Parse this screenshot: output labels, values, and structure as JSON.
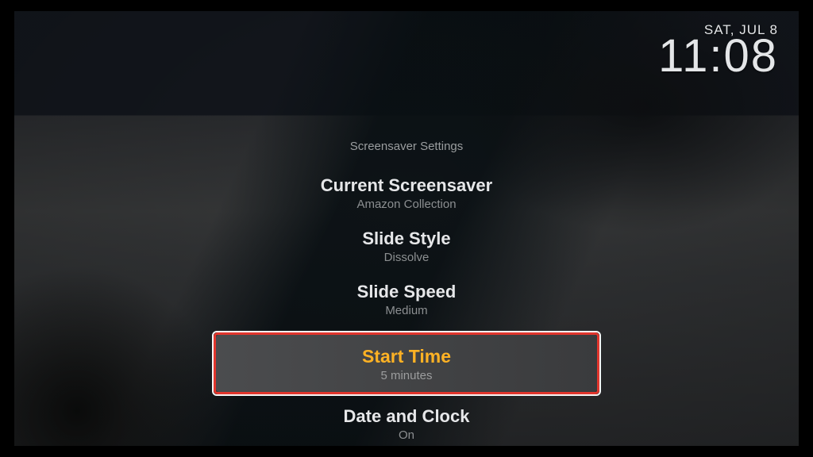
{
  "clock": {
    "date": "SAT, JUL 8",
    "time": "11:08"
  },
  "menu": {
    "title": "Screensaver Settings"
  },
  "items": [
    {
      "label": "Current Screensaver",
      "value": "Amazon Collection",
      "focused": false
    },
    {
      "label": "Slide Style",
      "value": "Dissolve",
      "focused": false
    },
    {
      "label": "Slide Speed",
      "value": "Medium",
      "focused": false
    },
    {
      "label": "Start Time",
      "value": "5 minutes",
      "focused": true
    },
    {
      "label": "Date and Clock",
      "value": "On",
      "focused": false
    }
  ],
  "colors": {
    "accent": "#ffb224",
    "annotation": "#e1362d"
  }
}
